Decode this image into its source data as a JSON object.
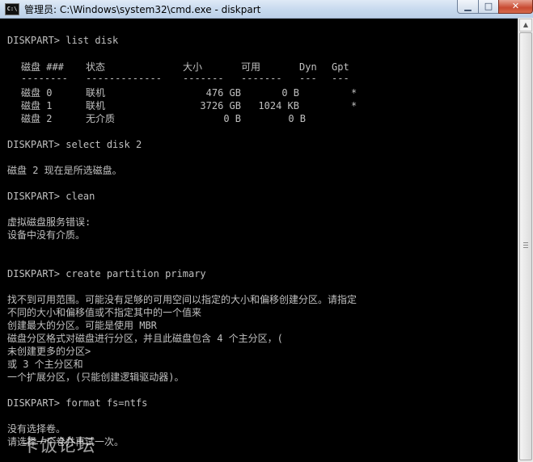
{
  "window": {
    "title": "管理员: C:\\Windows\\system32\\cmd.exe - diskpart",
    "app_icon_label": "C:\\",
    "min_glyph": "▁",
    "max_glyph": "□",
    "close_glyph": "✕"
  },
  "console": {
    "cmd_list_disk": "DISKPART> list disk",
    "table": {
      "headers": [
        "磁盘 ###",
        "状态",
        "大小",
        "可用",
        "Dyn",
        "Gpt"
      ],
      "separators": [
        "--------",
        "-------------",
        "-------",
        "-------",
        "---",
        "---"
      ],
      "rows": [
        [
          "磁盘 0",
          "联机",
          "476 GB",
          "0 B",
          "",
          "*"
        ],
        [
          "磁盘 1",
          "联机",
          "3726 GB",
          "1024 KB",
          "",
          "*"
        ],
        [
          "磁盘 2",
          "无介质",
          "0 B",
          "0 B",
          "",
          ""
        ]
      ]
    },
    "cmd_select": "DISKPART> select disk 2",
    "select_result": "磁盘 2 现在是所选磁盘。",
    "cmd_clean": "DISKPART> clean",
    "clean_error_1": "虚拟磁盘服务错误:",
    "clean_error_2": "设备中没有介质。",
    "cmd_create": "DISKPART> create partition primary",
    "create_error": [
      "找不到可用范围。可能没有足够的可用空间以指定的大小和偏移创建分区。请指定",
      "不同的大小和偏移值或不指定其中的一个值来",
      "创建最大的分区。可能是使用 MBR",
      "磁盘分区格式对磁盘进行分区，并且此磁盘包含 4 个主分区，(",
      "未创建更多的分区>",
      "或 3 个主分区和",
      "一个扩展分区，(只能创建逻辑驱动器)。"
    ],
    "cmd_format": "DISKPART> format fs=ntfs",
    "format_error_1": "没有选择卷。",
    "format_error_2": "请选择一个卷并再试一次。"
  },
  "scrollbar": {
    "up_glyph": "▲",
    "down_glyph": "▼"
  },
  "watermark": "卡饭论坛"
}
